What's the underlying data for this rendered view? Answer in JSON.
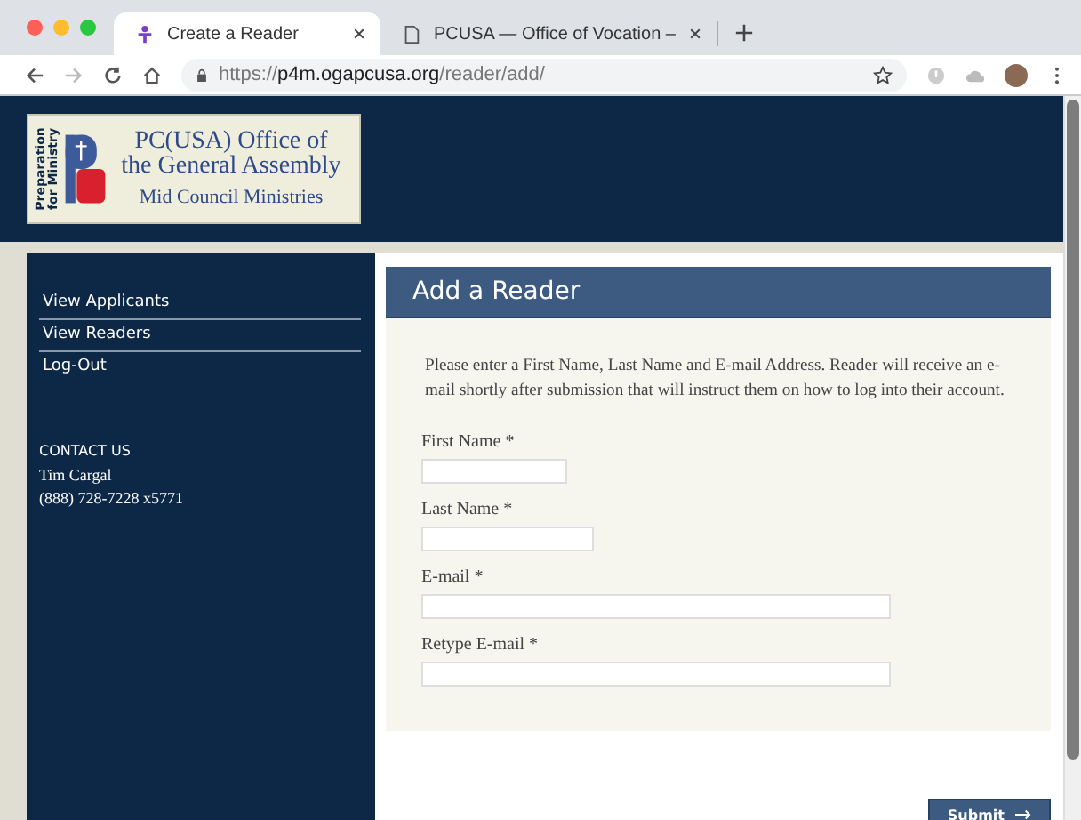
{
  "browser": {
    "tabs": [
      {
        "title": "Create a Reader",
        "selected": true,
        "kind": "site"
      },
      {
        "title": "PCUSA — Office of Vocation –",
        "selected": false,
        "kind": "page"
      }
    ],
    "url": {
      "scheme": "https://",
      "host": "p4m.ogapcusa.org",
      "path": "/reader/add/"
    }
  },
  "header": {
    "logo": {
      "side_text": [
        "Preparation",
        "for Ministry"
      ],
      "title_lines": [
        "PC(USA) Office of",
        "the General Assembly"
      ],
      "subtitle": "Mid Council Ministries"
    }
  },
  "sidebar": {
    "items": [
      {
        "label": "View Applicants",
        "selected": false
      },
      {
        "label": "View Readers",
        "selected": false
      },
      {
        "label": "Log-Out",
        "selected": false
      }
    ],
    "contact": {
      "heading": "CONTACT US",
      "lines": [
        "Tim Cargal",
        "(888) 728-7228 x5771"
      ]
    }
  },
  "form": {
    "title": "Add a Reader",
    "intro": "Please enter a First Name, Last Name and E-mail Address. Reader will receive an e-mail shortly after submission that will instruct them on how to log into their account.",
    "fields": [
      {
        "label": "First Name *",
        "kind": "short"
      },
      {
        "label": "Last Name *",
        "kind": "medium"
      },
      {
        "label": "E-mail *",
        "kind": "long"
      },
      {
        "label": "Retype E-mail *",
        "kind": "long"
      }
    ],
    "submit": "Submit"
  }
}
